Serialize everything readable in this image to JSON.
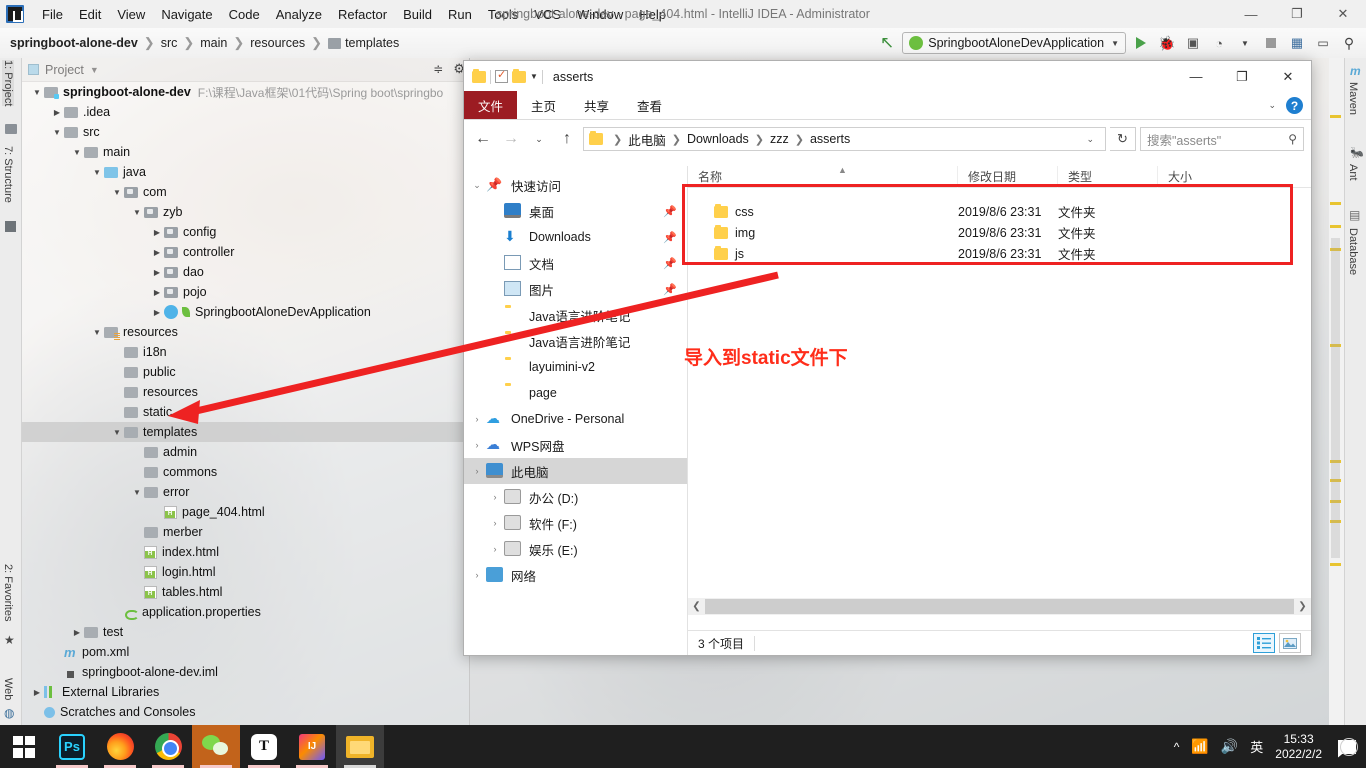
{
  "ide": {
    "window_title": "springboot-alone-dev - page_404.html - IntelliJ IDEA - Administrator",
    "menu": [
      "File",
      "Edit",
      "View",
      "Navigate",
      "Code",
      "Analyze",
      "Refactor",
      "Build",
      "Run",
      "Tools",
      "VCS",
      "Window",
      "Help"
    ],
    "win_buttons": {
      "minimize": "—",
      "maximize": "❐",
      "close": "✕"
    },
    "breadcrumb": [
      "springboot-alone-dev",
      "src",
      "main",
      "resources",
      "templates"
    ],
    "run_config": "SpringbootAloneDevApplication",
    "left_tabs": [
      "1: Project",
      "7: Structure",
      "2: Favorites",
      "Web"
    ],
    "right_tabs": [
      "Maven",
      "Ant",
      "Database"
    ],
    "project_panel": {
      "title": "Project",
      "root": "springboot-alone-dev",
      "root_path": "F:\\课程\\Java框架\\01代码\\Spring boot\\springbo",
      "tree": [
        {
          "label": ".idea",
          "indent": 1,
          "arrow": "collapsed",
          "icon": "folder"
        },
        {
          "label": "src",
          "indent": 1,
          "arrow": "expanded",
          "icon": "folder"
        },
        {
          "label": "main",
          "indent": 2,
          "arrow": "expanded",
          "icon": "folder"
        },
        {
          "label": "java",
          "indent": 3,
          "arrow": "expanded",
          "icon": "folder-source"
        },
        {
          "label": "com",
          "indent": 4,
          "arrow": "expanded",
          "icon": "package"
        },
        {
          "label": "zyb",
          "indent": 5,
          "arrow": "expanded",
          "icon": "package"
        },
        {
          "label": "config",
          "indent": 6,
          "arrow": "collapsed",
          "icon": "package"
        },
        {
          "label": "controller",
          "indent": 6,
          "arrow": "collapsed",
          "icon": "package"
        },
        {
          "label": "dao",
          "indent": 6,
          "arrow": "collapsed",
          "icon": "package"
        },
        {
          "label": "pojo",
          "indent": 6,
          "arrow": "collapsed",
          "icon": "package"
        },
        {
          "label": "SpringbootAloneDevApplication",
          "indent": 6,
          "arrow": "collapsed",
          "icon": "spring-class"
        },
        {
          "label": "resources",
          "indent": 3,
          "arrow": "expanded",
          "icon": "folder-resource"
        },
        {
          "label": "i18n",
          "indent": 4,
          "arrow": "none",
          "icon": "folder"
        },
        {
          "label": "public",
          "indent": 4,
          "arrow": "none",
          "icon": "folder"
        },
        {
          "label": "resources",
          "indent": 4,
          "arrow": "none",
          "icon": "folder"
        },
        {
          "label": "static",
          "indent": 4,
          "arrow": "none",
          "icon": "folder"
        },
        {
          "label": "templates",
          "indent": 4,
          "arrow": "expanded",
          "icon": "folder",
          "selected": true
        },
        {
          "label": "admin",
          "indent": 5,
          "arrow": "none",
          "icon": "folder"
        },
        {
          "label": "commons",
          "indent": 5,
          "arrow": "none",
          "icon": "folder"
        },
        {
          "label": "error",
          "indent": 5,
          "arrow": "expanded",
          "icon": "folder"
        },
        {
          "label": "page_404.html",
          "indent": 6,
          "arrow": "none",
          "icon": "html"
        },
        {
          "label": "merber",
          "indent": 5,
          "arrow": "none",
          "icon": "folder"
        },
        {
          "label": "index.html",
          "indent": 5,
          "arrow": "none",
          "icon": "html"
        },
        {
          "label": "login.html",
          "indent": 5,
          "arrow": "none",
          "icon": "html"
        },
        {
          "label": "tables.html",
          "indent": 5,
          "arrow": "none",
          "icon": "html"
        },
        {
          "label": "application.properties",
          "indent": 4,
          "arrow": "none",
          "icon": "properties"
        },
        {
          "label": "test",
          "indent": 2,
          "arrow": "collapsed",
          "icon": "folder"
        },
        {
          "label": "pom.xml",
          "indent": 1,
          "arrow": "none",
          "icon": "maven"
        },
        {
          "label": "springboot-alone-dev.iml",
          "indent": 1,
          "arrow": "none",
          "icon": "iml"
        },
        {
          "label": "External Libraries",
          "indent": 0,
          "arrow": "collapsed",
          "icon": "library"
        },
        {
          "label": "Scratches and Consoles",
          "indent": 0,
          "arrow": "none",
          "icon": "scratch"
        }
      ]
    }
  },
  "explorer": {
    "title": "asserts",
    "win_buttons": {
      "minimize": "—",
      "maximize": "❐",
      "close": "✕"
    },
    "ribbon": {
      "file": "文件",
      "tabs": [
        "主页",
        "共享",
        "查看"
      ],
      "help": "?"
    },
    "address": {
      "crumbs": [
        "此电脑",
        "Downloads",
        "zzz",
        "asserts"
      ],
      "refresh_icon": "↻"
    },
    "search": {
      "placeholder": "搜索\"asserts\"",
      "icon": "search-icon"
    },
    "nav_items": [
      {
        "label": "快速访问",
        "icon": "pin-star",
        "chevron": "open",
        "indent": 0,
        "pin": false
      },
      {
        "label": "桌面",
        "icon": "desktop",
        "chevron": "none",
        "indent": 1,
        "pin": true
      },
      {
        "label": "Downloads",
        "icon": "download",
        "chevron": "none",
        "indent": 1,
        "pin": true
      },
      {
        "label": "文档",
        "icon": "document",
        "chevron": "none",
        "indent": 1,
        "pin": true
      },
      {
        "label": "图片",
        "icon": "picture",
        "chevron": "none",
        "indent": 1,
        "pin": true
      },
      {
        "label": "Java语言进阶笔记",
        "icon": "folder",
        "chevron": "none",
        "indent": 1,
        "pin": false
      },
      {
        "label": "Java语言进阶笔记",
        "icon": "folder",
        "chevron": "none",
        "indent": 1,
        "pin": false
      },
      {
        "label": "layuimini-v2",
        "icon": "folder",
        "chevron": "none",
        "indent": 1,
        "pin": false
      },
      {
        "label": "page",
        "icon": "folder",
        "chevron": "none",
        "indent": 1,
        "pin": false
      },
      {
        "label": "OneDrive - Personal",
        "icon": "cloud",
        "chevron": "closed",
        "indent": 0,
        "pin": false
      },
      {
        "label": "WPS网盘",
        "icon": "cloud-wps",
        "chevron": "closed",
        "indent": 0,
        "pin": false
      },
      {
        "label": "此电脑",
        "icon": "computer",
        "chevron": "closed",
        "indent": 0,
        "pin": false,
        "selected": true
      },
      {
        "label": "办公 (D:)",
        "icon": "drive",
        "chevron": "closed",
        "indent": 1,
        "pin": false
      },
      {
        "label": "软件 (F:)",
        "icon": "drive",
        "chevron": "closed",
        "indent": 1,
        "pin": false
      },
      {
        "label": "娱乐 (E:)",
        "icon": "drive",
        "chevron": "closed",
        "indent": 1,
        "pin": false
      },
      {
        "label": "网络",
        "icon": "network",
        "chevron": "closed",
        "indent": 0,
        "pin": false
      }
    ],
    "columns": [
      "名称",
      "修改日期",
      "类型",
      "大小"
    ],
    "files": [
      {
        "name": "css",
        "date": "2019/8/6 23:31",
        "type": "文件夹",
        "size": ""
      },
      {
        "name": "img",
        "date": "2019/8/6 23:31",
        "type": "文件夹",
        "size": ""
      },
      {
        "name": "js",
        "date": "2019/8/6 23:31",
        "type": "文件夹",
        "size": ""
      }
    ],
    "status": "3 个项目",
    "view_buttons": [
      "details-view-icon",
      "large-icons-view-icon"
    ]
  },
  "annotation": {
    "note": "导入到static文件下",
    "color": "#ff2d1a"
  },
  "taskbar": {
    "items": [
      "start-icon",
      "photoshop-icon",
      "firefox-icon",
      "chrome-icon",
      "wechat-icon",
      "typora-icon",
      "intellij-idea-icon",
      "file-explorer-icon"
    ],
    "tray": {
      "chevron": "^",
      "network": "network-icon",
      "volume": "volume-icon",
      "ime": "英"
    },
    "clock": {
      "time": "15:33",
      "date": "2022/2/2"
    },
    "notification_count": "1"
  }
}
